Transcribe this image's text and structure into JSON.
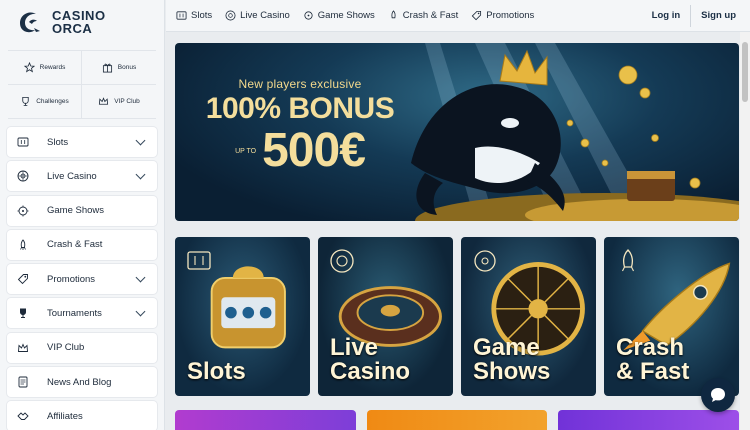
{
  "brand": {
    "line1": "CASINO",
    "line2": "ORCA"
  },
  "quick_links": [
    {
      "label": "Rewards",
      "icon": "star-icon"
    },
    {
      "label": "Bonus",
      "icon": "gift-icon"
    },
    {
      "label": "Challenges",
      "icon": "trophy-icon"
    },
    {
      "label": "VIP Club",
      "icon": "crown-icon"
    }
  ],
  "sidebar": {
    "items": [
      {
        "label": "Slots",
        "icon": "slot-machine-icon",
        "has_chevron": true
      },
      {
        "label": "Live Casino",
        "icon": "roulette-icon",
        "has_chevron": true
      },
      {
        "label": "Game Shows",
        "icon": "wheel-icon",
        "has_chevron": false
      },
      {
        "label": "Crash & Fast",
        "icon": "rocket-icon",
        "has_chevron": false
      },
      {
        "label": "Promotions",
        "icon": "promo-icon",
        "has_chevron": true
      },
      {
        "label": "Tournaments",
        "icon": "trophy-icon",
        "has_chevron": true
      },
      {
        "label": "VIP Club",
        "icon": "crown-icon",
        "has_chevron": false
      },
      {
        "label": "News And Blog",
        "icon": "document-icon",
        "has_chevron": false
      },
      {
        "label": "Affiliates",
        "icon": "handshake-icon",
        "has_chevron": false
      }
    ]
  },
  "topnav": {
    "items": [
      {
        "label": "Slots",
        "icon": "slot-machine-icon"
      },
      {
        "label": "Live Casino",
        "icon": "roulette-icon"
      },
      {
        "label": "Game Shows",
        "icon": "wheel-icon"
      },
      {
        "label": "Crash & Fast",
        "icon": "rocket-icon"
      },
      {
        "label": "Promotions",
        "icon": "promo-icon"
      }
    ],
    "login": "Log in",
    "signup": "Sign up"
  },
  "hero": {
    "subtitle": "New players exclusive",
    "headline": "100% BONUS",
    "upto": "UP TO",
    "amount": "500€"
  },
  "tiles": [
    {
      "line1": "Slots",
      "line2": ""
    },
    {
      "line1": "Live",
      "line2": "Casino"
    },
    {
      "line1": "Game",
      "line2": "Shows"
    },
    {
      "line1": "Crash",
      "line2": "& Fast"
    }
  ],
  "colors": {
    "brand_dark": "#1b2f45",
    "sidebar_bg": "#f4f6f8",
    "tile_text": "#fff5d6",
    "gold": "#f4de9c"
  }
}
